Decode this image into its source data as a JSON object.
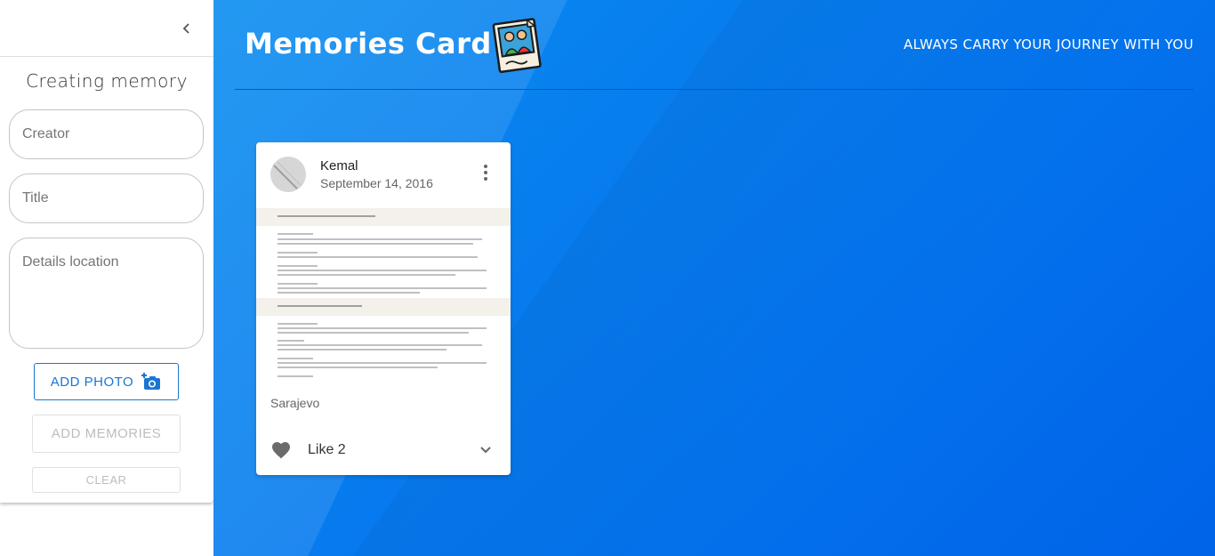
{
  "sidebar": {
    "form_title": "Creating memory",
    "creator_placeholder": "Creator",
    "title_placeholder": "Title",
    "details_placeholder": "Details location",
    "add_photo_label": "ADD PHOTO",
    "add_memories_label": "ADD MEMORIES",
    "clear_label": "CLEAR"
  },
  "header": {
    "title": "Memories Card",
    "tagline": "ALWAYS CARRY YOUR JOURNEY WITH YOU"
  },
  "card": {
    "author": "Kemal",
    "date": "September 14, 2016",
    "location": "Sarajevo",
    "like_label": "Like 2"
  },
  "colors": {
    "accent": "#1976d2",
    "background_blue": "#0679ee"
  }
}
